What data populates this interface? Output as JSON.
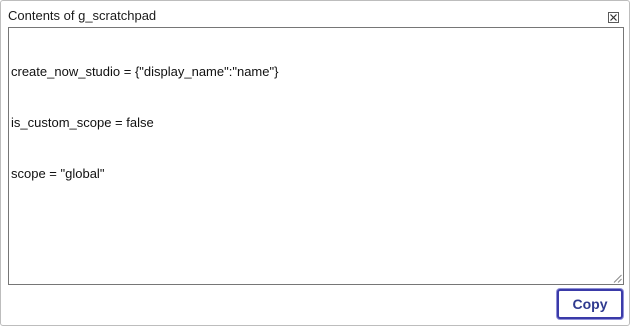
{
  "dialog": {
    "title": "Contents of g_scratchpad",
    "close_icon": "close-icon",
    "textarea": {
      "lines": [
        "create_now_studio = {\"display_name\":\"name\"}",
        "is_custom_scope = false",
        "scope = \"global\""
      ]
    },
    "copy_label": "Copy"
  },
  "colors": {
    "copy_border": "#3a3aa8",
    "copy_text": "#2f3a8f",
    "dialog_border": "#bdbdbd",
    "textarea_border": "#767676"
  }
}
